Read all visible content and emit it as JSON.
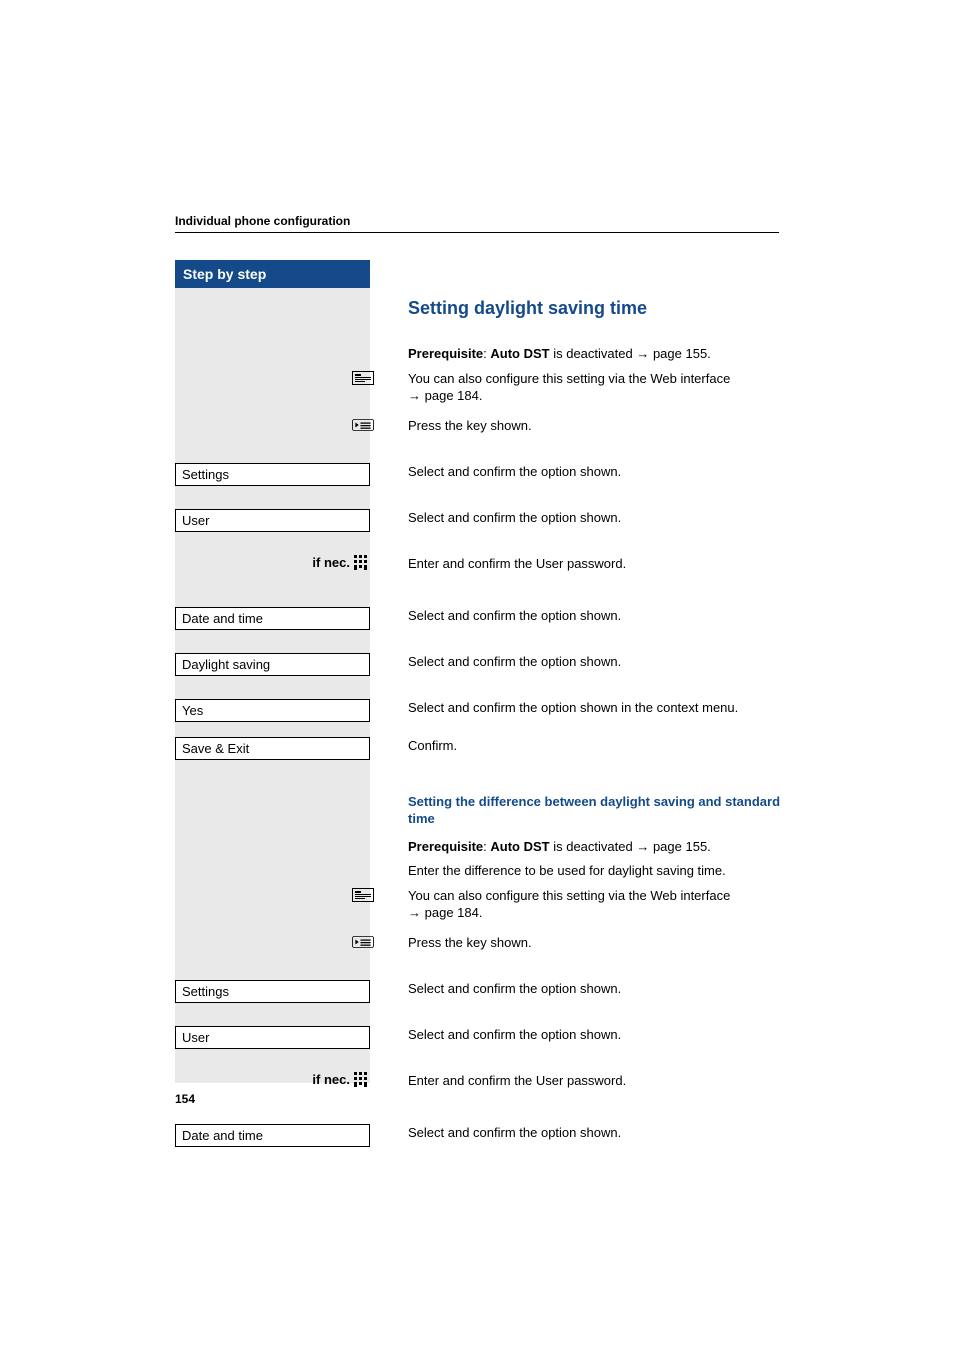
{
  "header": {
    "title": "Individual phone configuration"
  },
  "sidebar": {
    "title": "Step by step"
  },
  "section1": {
    "heading": "Setting daylight saving time",
    "prereq_prefix": "Prerequisite",
    "prereq_bold": "Auto DST",
    "prereq_rest": " is deactivated ",
    "prereq_ref": "page 155.",
    "web_line1": "You can also configure this setting via the Web interface",
    "web_ref": "page 184.",
    "press_key": "Press the key shown.",
    "settings_box": "Settings",
    "settings_txt": "Select and confirm the option shown.",
    "user_box": "User",
    "user_txt": "Select and confirm the option shown.",
    "ifnec": "if nec.",
    "ifnec_txt": "Enter and confirm the User password.",
    "date_box": "Date and time",
    "date_txt": "Select and confirm the option shown.",
    "daylight_box": "Daylight saving",
    "daylight_txt": "Select and confirm the option shown.",
    "yes_box": "Yes",
    "yes_txt": "Select and confirm the option shown in the context menu.",
    "save_box": "Save & Exit",
    "save_txt": "Confirm."
  },
  "section2": {
    "heading": "Setting the difference between daylight saving and standard time",
    "prereq_prefix": "Prerequisite",
    "prereq_bold": "Auto DST",
    "prereq_rest": " is deactivated ",
    "prereq_ref": "page 155.",
    "enter_diff": "Enter the difference to be used for daylight saving time.",
    "web_line1": "You can also configure this setting via the Web interface",
    "web_ref": "page 184.",
    "press_key": "Press the key shown.",
    "settings_box": "Settings",
    "settings_txt": "Select and confirm the option shown.",
    "user_box": "User",
    "user_txt": "Select and confirm the option shown.",
    "ifnec": "if nec.",
    "ifnec_txt": "Enter and confirm the User password.",
    "date_box": "Date and time",
    "date_txt": "Select and confirm the option shown."
  },
  "page_number": "154",
  "icons": {
    "web": "web-config-icon",
    "menu": "menu-key-icon",
    "keypad": "keypad-icon"
  }
}
